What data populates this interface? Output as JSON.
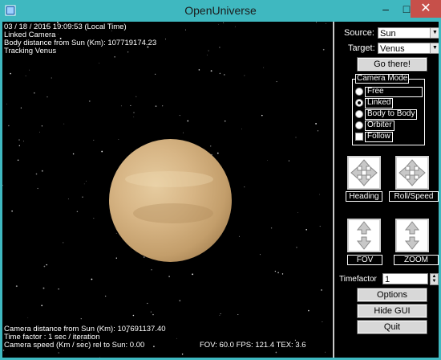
{
  "window": {
    "title": "OpenUniverse",
    "minimize": "–",
    "maximize": "□",
    "close": "✕"
  },
  "hud": {
    "date_line": "03 / 18 / 2015  19:09:53 (Local Time)",
    "camera_mode_line": "Linked Camera",
    "body_distance_line": "Body distance from Sun (Km): 107719174.23",
    "tracking_line": "Tracking Venus",
    "camera_distance_line": "Camera distance from Sun (Km): 107691137.40",
    "time_factor_line": "Time factor : 1 sec / iteration",
    "camera_speed_line": "Camera speed (Km / sec) rel to Sun: 0.00",
    "stats_line": "FOV: 60.0  FPS: 121.4 TEX: 3.6"
  },
  "panel": {
    "source_label": "Source:",
    "source_value": "Sun",
    "target_label": "Target:",
    "target_value": "Venus",
    "go_button": "Go there!",
    "camera_mode": {
      "title": "Camera Mode",
      "options": [
        {
          "label": "Free",
          "selected": false
        },
        {
          "label": "Linked",
          "selected": true
        },
        {
          "label": "Body to Body",
          "selected": false
        },
        {
          "label": "Orbiter",
          "selected": false
        }
      ],
      "follow_label": "Follow",
      "follow_checked": false
    },
    "heading_label": "Heading",
    "roll_speed_label": "Roll/Speed",
    "fov_label": "FOV",
    "zoom_label": "ZOOM",
    "timefactor_label": "Timefactor",
    "timefactor_value": "1",
    "options_button": "Options",
    "hide_gui_button": "Hide GUI",
    "quit_button": "Quit"
  }
}
